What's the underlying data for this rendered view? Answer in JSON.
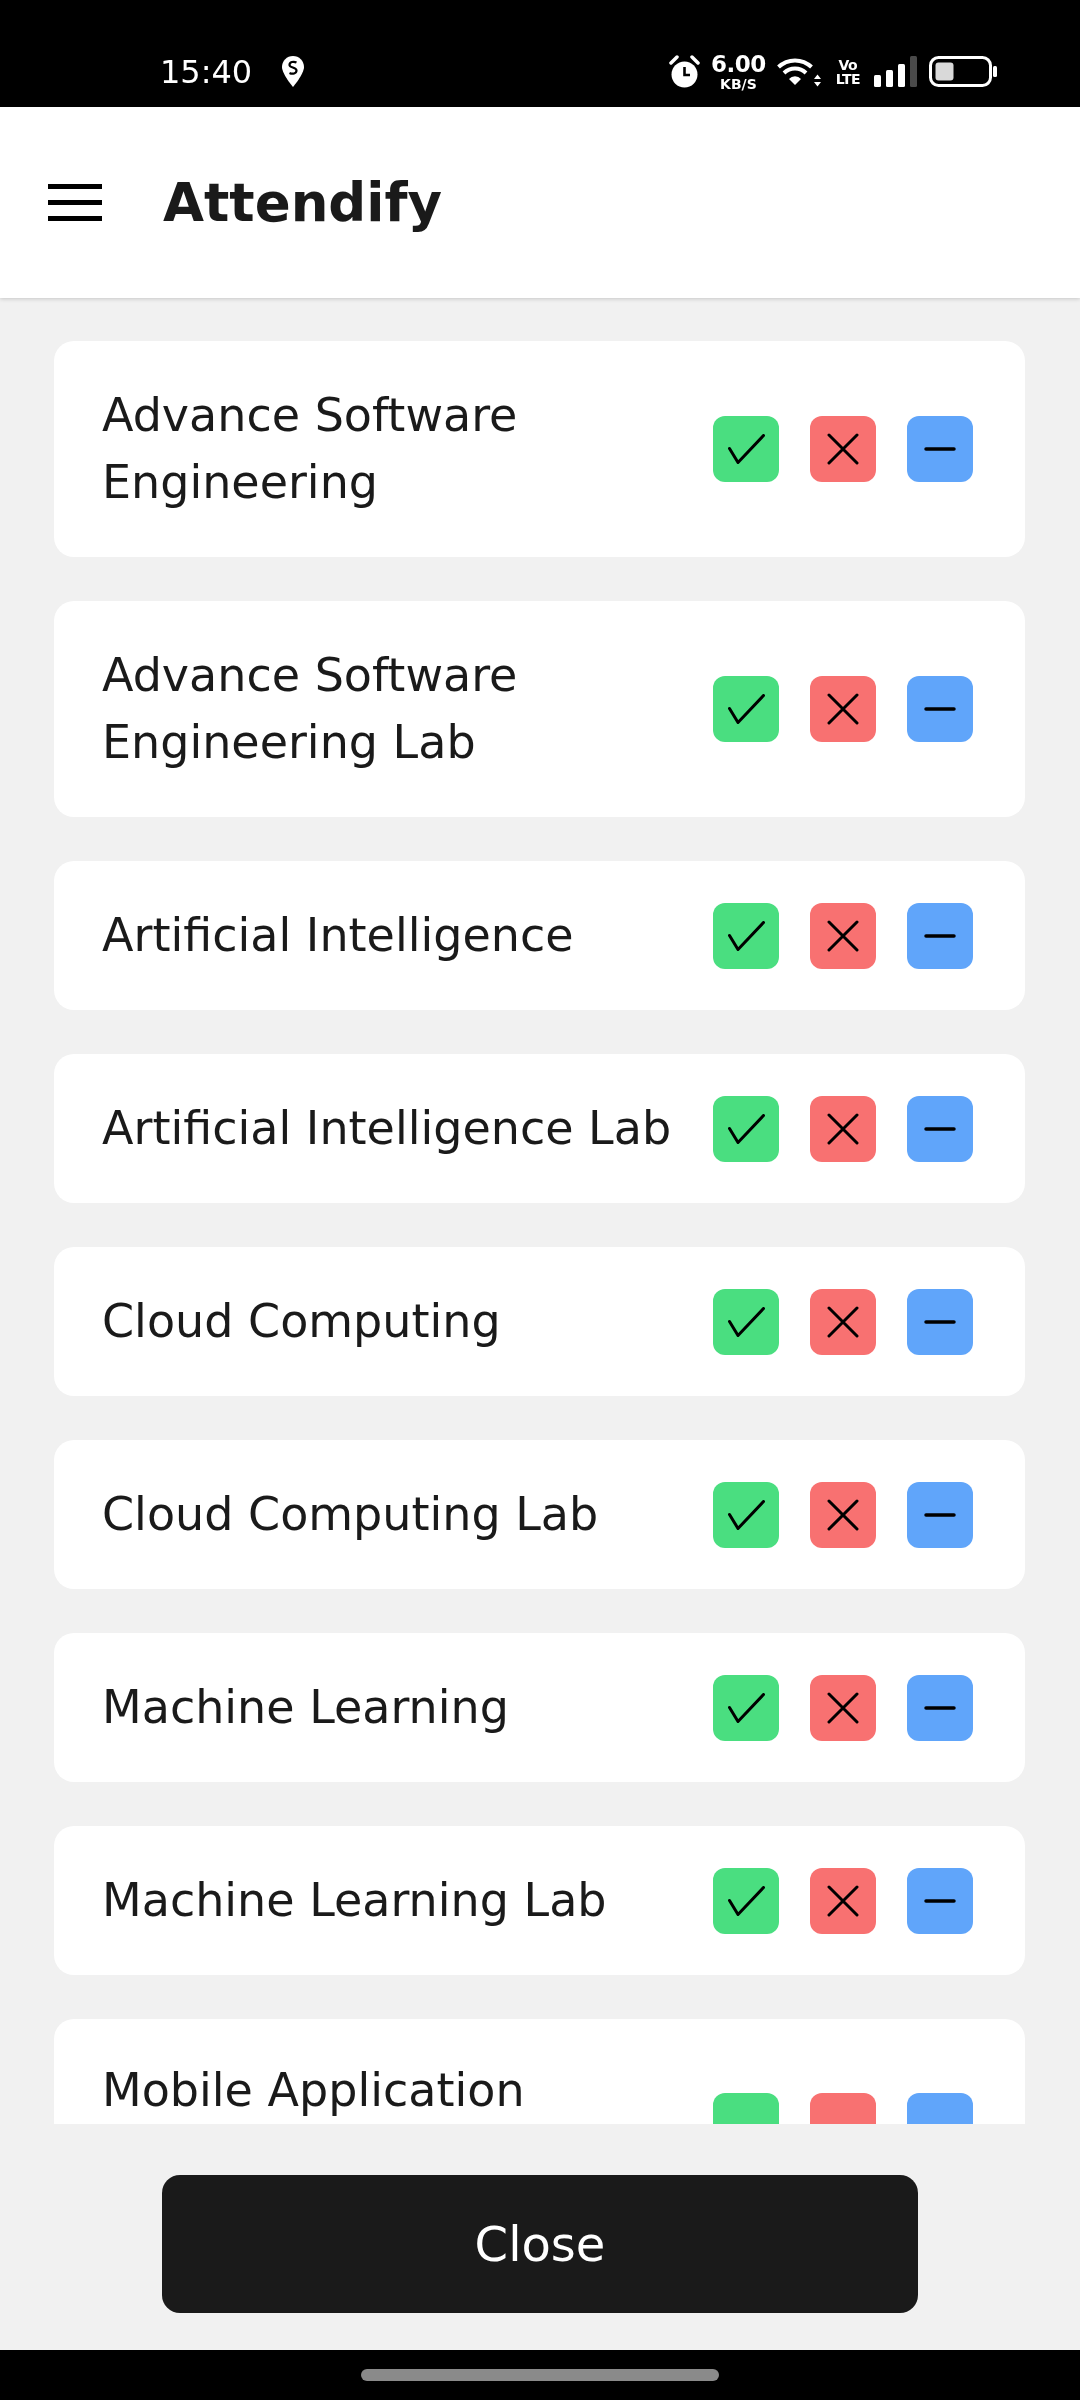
{
  "status_bar": {
    "time": "15:40",
    "network_speed": {
      "value": "6.00",
      "unit": "KB/S"
    },
    "network_type": {
      "top": "Vo",
      "bottom": "LTE"
    }
  },
  "app_bar": {
    "title": "Attendify"
  },
  "subjects": [
    "Advance Software Engineering",
    "Advance Software Engineering Lab",
    "Artificial Intelligence",
    "Artificial Intelligence Lab",
    "Cloud Computing",
    "Cloud Computing Lab",
    "Machine Learning",
    "Machine Learning Lab",
    "Mobile Application"
  ],
  "close_button": {
    "label": "Close"
  }
}
